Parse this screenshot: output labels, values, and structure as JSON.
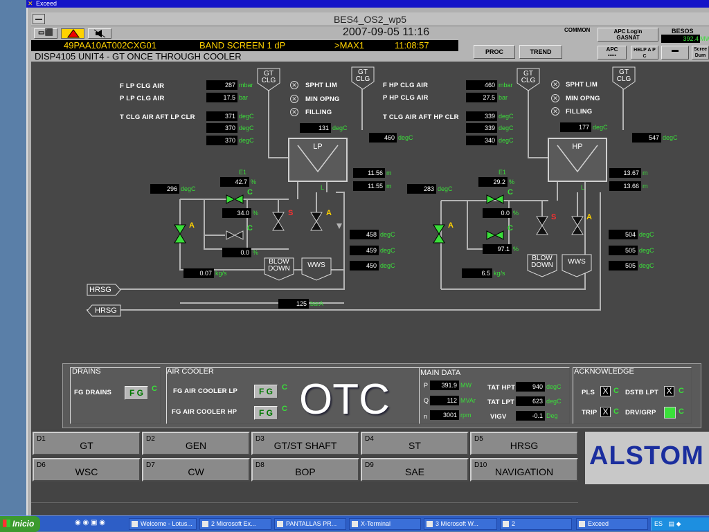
{
  "exceed_title": "Exceed",
  "window_title": "BES4_OS2_wp5",
  "header": {
    "datetime": "2007-09-05 11:16",
    "tag": "49PAA10AT002CXG01",
    "alarm_text": "BAND SCREEN 1 dP",
    "alarm_cond": ">MAX1",
    "alarm_time": "11:08:57",
    "display": "DISP4105  UNIT4 - GT ONCE THROUGH COOLER",
    "common_label": "COMMON",
    "apc_login": "APC Login",
    "gasnat": "GASNAT",
    "besos_label": "BESOS",
    "besos_value": "392.4",
    "besos_unit": "MW",
    "proc_label": "PROC",
    "trend_label": "TREND",
    "apc_label": "APC",
    "help_apc": "HELP A P C",
    "screen_dump": "Scree Dum"
  },
  "lp": {
    "title": "LP",
    "f_label": "F LP CLG AIR",
    "f_value": "287",
    "f_unit": "mbar",
    "p_label": "P LP CLG AIR",
    "p_value": "17.5",
    "p_unit": "bar",
    "t_label": "T CLG AIR AFT LP CLR",
    "t_values": [
      "371",
      "370",
      "370"
    ],
    "t_unit": "degC",
    "spht": "SPHT LIM",
    "minopng": "MIN OPNG",
    "filling": "FILLING",
    "gt_clg1": "GT CLG",
    "gt_clg2": "GT CLG",
    "t131": "131",
    "t460": "460",
    "degc": "degC",
    "level1": "11.56",
    "level2": "11.55",
    "level_unit": "m",
    "t296": "296",
    "e1": "E1",
    "e1_value": "42.7",
    "pct": "%",
    "v1_value": "34.0",
    "v2_value": "0.0",
    "flow": "0.07",
    "flow_unit": "kg/s",
    "out_temps": [
      "458",
      "459",
      "450"
    ],
    "blowdown": "BLOW DOWN",
    "wws": "WWS",
    "press": "125",
    "press_unit": "barA",
    "hrsg1": "HRSG",
    "hrsg2": "HRSG"
  },
  "hp": {
    "title": "HP",
    "f_label": "F HP CLG AIR",
    "f_value": "460",
    "f_unit": "mbar",
    "p_label": "P HP CLG AIR",
    "p_value": "27.5",
    "p_unit": "bar",
    "t_label": "T CLG AIR AFT HP CLR",
    "t_values": [
      "339",
      "339",
      "340"
    ],
    "spht": "SPHT LIM",
    "minopng": "MIN OPNG",
    "filling": "FILLING",
    "gt_clg1": "GT CLG",
    "gt_clg2": "GT CLG",
    "t177": "177",
    "t547": "547",
    "level1": "13.67",
    "level2": "13.66",
    "t283": "283",
    "e1": "E1",
    "e1_value": "29.2",
    "v1_value": "0.0",
    "v2_value": "97.1",
    "flow": "6.5",
    "flow_unit": "kg/s",
    "out_temps": [
      "504",
      "505",
      "505"
    ],
    "blowdown": "BLOW DOWN",
    "wws": "WWS"
  },
  "valve_letters": {
    "a": "A",
    "c": "C",
    "s": "S",
    "l": "L"
  },
  "bottom": {
    "drains_title": "DRAINS",
    "fg_drains": "FG DRAINS",
    "air_cooler_title": "AIR COOLER",
    "fg_lp": "FG AIR COOLER LP",
    "fg_hp": "FG AIR COOLER HP",
    "fg": "F G",
    "c": "C",
    "otc": "OTC",
    "main_title": "MAIN DATA",
    "p": "P",
    "p_value": "391.9",
    "p_unit": "MW",
    "q": "Q",
    "q_value": "112",
    "q_unit": "MVAr",
    "n": "n",
    "n_value": "3001",
    "n_unit": "rpm",
    "tat_hpt": "TAT HPT",
    "tat_hpt_value": "940",
    "tat_lpt": "TAT LPT",
    "tat_lpt_value": "623",
    "vigv": "VIGV",
    "vigv_value": "-0.1",
    "vigv_unit": "Deg",
    "degc": "degC",
    "ack_title": "ACKNOWLEDGE",
    "pls": "PLS",
    "dstb": "DSTB LPT",
    "trip": "TRIP",
    "drv": "DRV/GRP",
    "x": "X"
  },
  "nav": [
    {
      "code": "D1",
      "name": "GT"
    },
    {
      "code": "D2",
      "name": "GEN"
    },
    {
      "code": "D3",
      "name": "GT/ST SHAFT"
    },
    {
      "code": "D4",
      "name": "ST"
    },
    {
      "code": "D5",
      "name": "HRSG"
    },
    {
      "code": "D6",
      "name": "WSC"
    },
    {
      "code": "D7",
      "name": "CW"
    },
    {
      "code": "D8",
      "name": "BOP"
    },
    {
      "code": "D9",
      "name": "SAE"
    },
    {
      "code": "D10",
      "name": "NAVIGATION"
    }
  ],
  "logo": "ALSTOM",
  "taskbar": {
    "start": "Inicio",
    "items": [
      "Welcome - Lotus...",
      "2 Microsoft Ex...",
      "PANTALLAS PR...",
      "X-Terminal",
      "3 Microsoft W...",
      "2",
      "Exceed"
    ],
    "tray": "ES"
  },
  "colors": {
    "green": "#3adf3a",
    "pipe": "#b4b4b4",
    "bg": "#474747"
  }
}
